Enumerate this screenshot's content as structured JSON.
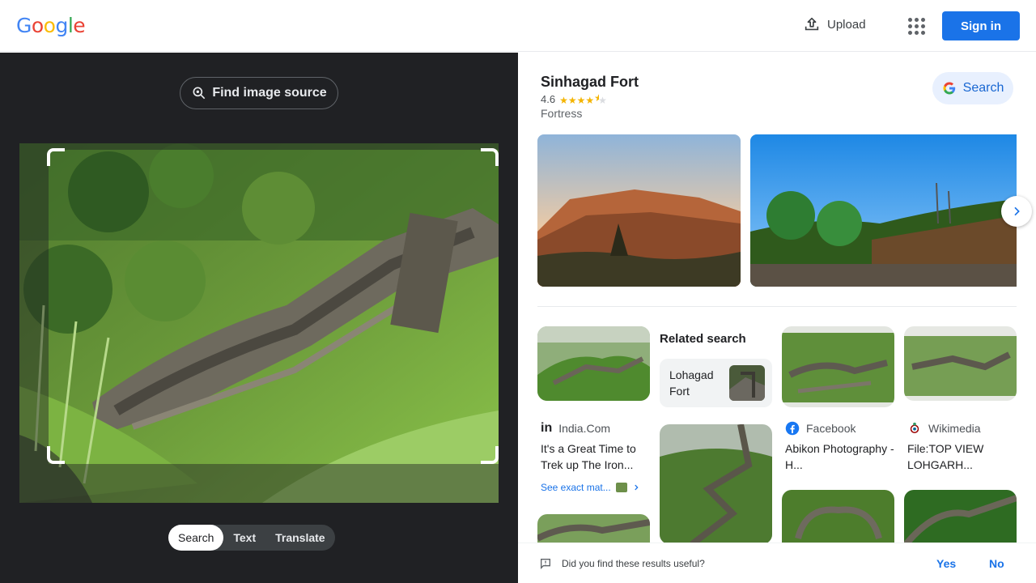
{
  "header": {
    "logo_letters": [
      "G",
      "o",
      "o",
      "g",
      "l",
      "e"
    ],
    "logo_colors": [
      "#4285f4",
      "#ea4335",
      "#fbbc05",
      "#4285f4",
      "#34a853",
      "#ea4335"
    ],
    "upload_label": "Upload",
    "signin_label": "Sign in"
  },
  "left_panel": {
    "find_source_label": "Find image source",
    "modes": [
      {
        "label": "Search",
        "active": true
      },
      {
        "label": "Text",
        "active": false
      },
      {
        "label": "Translate",
        "active": false
      }
    ]
  },
  "knowledge_panel": {
    "title": "Sinhagad Fort",
    "rating": "4.6",
    "stars": 4.6,
    "subtitle": "Fortress",
    "search_label": "Search"
  },
  "related": {
    "heading": "Related search",
    "chip_label": "Lohagad Fort"
  },
  "results": [
    {
      "source": "India.Com",
      "title": "It's a Great Time to Trek up The Iron...",
      "exact": "See exact mat..."
    },
    {
      "source": "Facebook",
      "title": "Abikon Photography - H..."
    },
    {
      "source": "Wikimedia",
      "title": "File:TOP VIEW LOHGARH..."
    }
  ],
  "feedback": {
    "question": "Did you find these results useful?",
    "yes": "Yes",
    "no": "No"
  },
  "colors": {
    "accent": "#1a73e8",
    "dark_panel": "#202124"
  }
}
